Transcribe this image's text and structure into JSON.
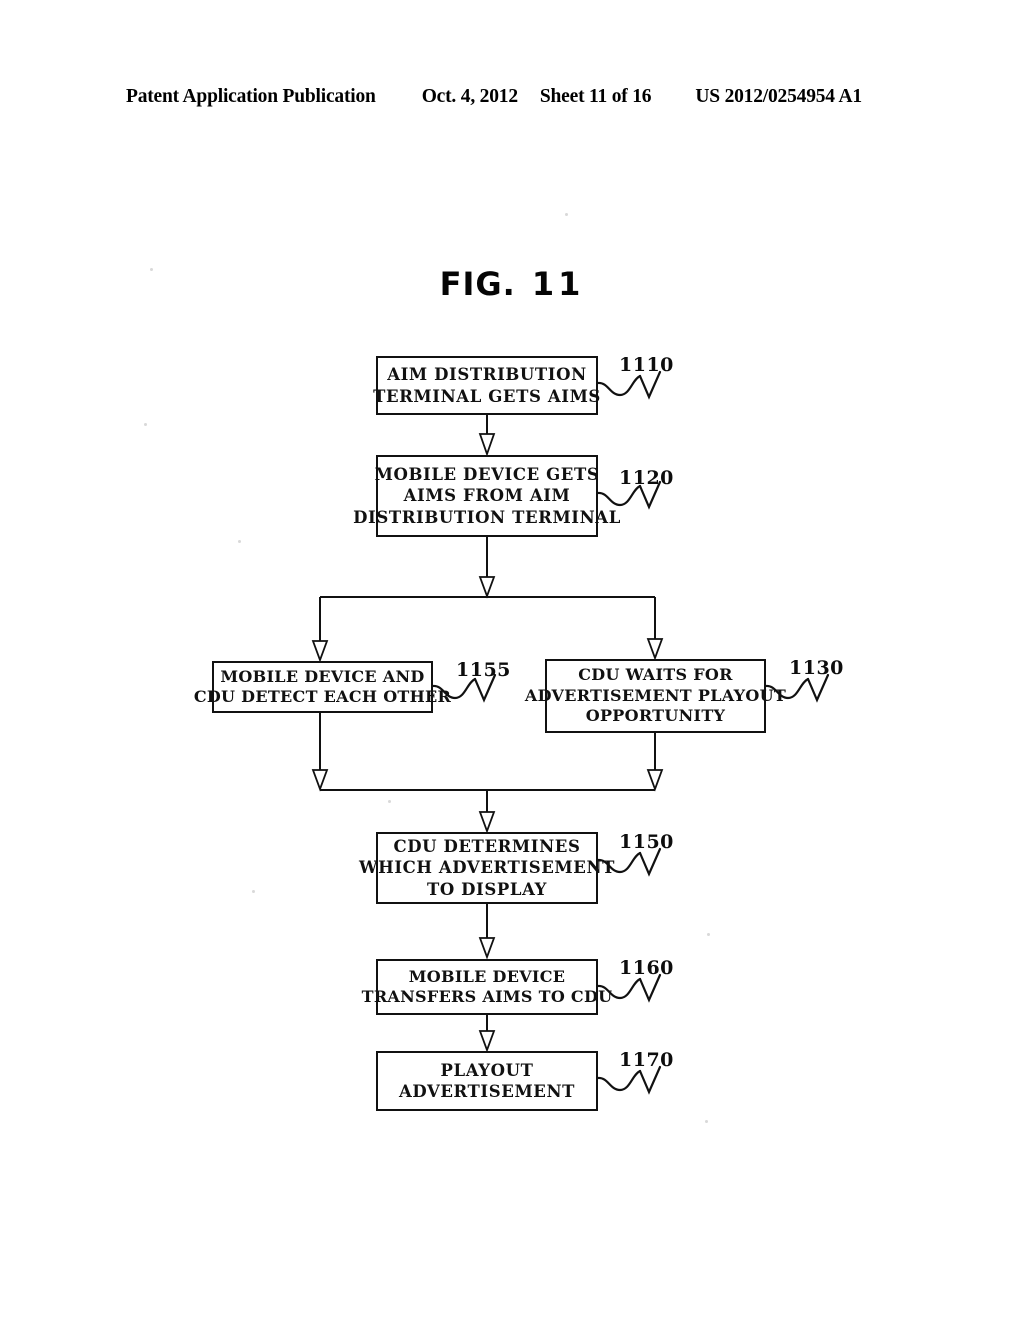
{
  "header": {
    "publication": "Patent Application Publication",
    "date": "Oct. 4, 2012",
    "sheet": "Sheet 11 of 16",
    "number": "US 2012/0254954 A1"
  },
  "figure": {
    "label": "FIG.",
    "number": "11"
  },
  "diagram": {
    "type": "flowchart",
    "nodes": [
      {
        "ref": "1110",
        "lines": [
          "AIM DISTRIBUTION",
          "TERMINAL GETS AIMS"
        ]
      },
      {
        "ref": "1120",
        "lines": [
          "MOBILE DEVICE GETS",
          "AIMS FROM AIM",
          "DISTRIBUTION TERMINAL"
        ]
      },
      {
        "ref": "1155",
        "lines": [
          "MOBILE DEVICE AND",
          "CDU DETECT EACH OTHER"
        ]
      },
      {
        "ref": "1130",
        "lines": [
          "CDU WAITS FOR",
          "ADVERTISEMENT PLAYOUT",
          "OPPORTUNITY"
        ]
      },
      {
        "ref": "1150",
        "lines": [
          "CDU DETERMINES",
          "WHICH ADVERTISEMENT",
          "TO DISPLAY"
        ]
      },
      {
        "ref": "1160",
        "lines": [
          "MOBILE DEVICE",
          "TRANSFERS AIMS TO CDU"
        ]
      },
      {
        "ref": "1170",
        "lines": [
          "PLAYOUT",
          "ADVERTISEMENT"
        ]
      }
    ]
  },
  "colors": {
    "ink": "#111111",
    "paper": "#ffffff"
  }
}
